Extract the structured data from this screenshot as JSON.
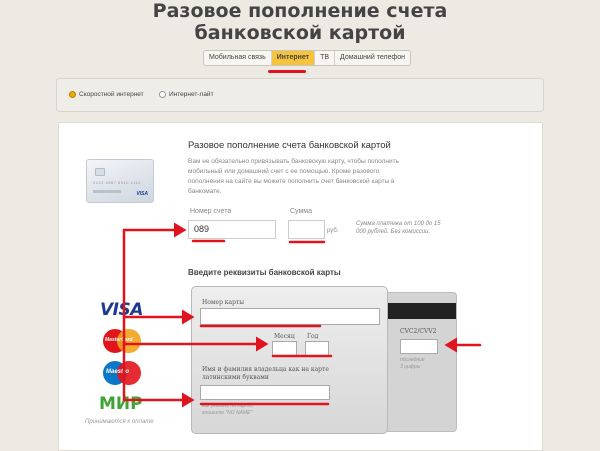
{
  "page": {
    "title_line1": "Разовое пополнение счета",
    "title_line2": "банковской картой"
  },
  "tabs": [
    {
      "label": "Мобильная связь",
      "active": false
    },
    {
      "label": "Интернет",
      "active": true
    },
    {
      "label": "ТВ",
      "active": false
    },
    {
      "label": "Домашний телефон",
      "active": false
    }
  ],
  "radios": [
    {
      "label": "Скоростной интернет",
      "selected": true
    },
    {
      "label": "Интернет-лайт",
      "selected": false
    }
  ],
  "form": {
    "heading": "Разовое пополнение счета банковской картой",
    "description": "Вам не обязательно привязывать банковскую карту, чтобы пополнить мобильный или домашний счет с ее помощью. Кроме разового пополнения на сайте вы можете пополнить счет банковской карты в банкомате.",
    "account_label": "Номер счета",
    "account_value": "089",
    "amount_label": "Сумма",
    "amount_value": "",
    "currency": "руб.",
    "amount_hint": "Сумма платежа от 100 до 15 000 рублей. Без комиссии."
  },
  "card_section": {
    "title": "Введите реквизиты банковской карты",
    "number_label": "Номер карты",
    "month_label": "Месяц",
    "year_label": "Год",
    "holder_label_line1": "Имя и фамилия владельца как на карте",
    "holder_label_line2": "латинскими буквами",
    "holder_note_line1": "как указано на карте,",
    "holder_note_line2": "впишите “NO NAME”",
    "cvc_label": "CVC2/CVV2",
    "cvc_note_line1": "последние",
    "cvc_note_line2": "3 цифры"
  },
  "payment_logos": {
    "visa": "VISA",
    "mastercard": "MasterCard",
    "maestro": "Maestro",
    "mir": "МИР",
    "accept_text": "Принимаются к оплате"
  },
  "sample_card": {
    "number_text": "0123 4567 8910 1112",
    "brand_text": "VISA"
  },
  "colors": {
    "active_tab": "#f6c33c",
    "annotation_red": "#e0141e",
    "panel_bg": "#ffffff",
    "page_bg": "#edeae4"
  }
}
